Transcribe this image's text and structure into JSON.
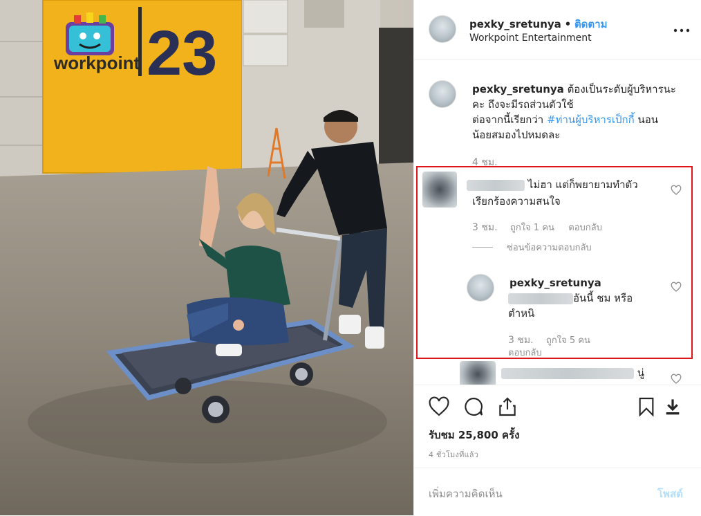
{
  "post": {
    "author": "pexky_sretunya",
    "follow_separator": "•",
    "follow_label": "ติดตาม",
    "location": "Workpoint Entertainment",
    "more_icon": "ellipsis-icon"
  },
  "media": {
    "sign_brand": "workpoint",
    "sign_number": "23"
  },
  "caption": {
    "author": "pexky_sretunya",
    "line1": "ต้องเป็นระดับผู้บริหารนะ",
    "line2": "คะ ถึงจะมีรถส่วนตัวใช้",
    "line3_prefix": "ต่อจากนี้เรียกว่า",
    "hashtag": "#ท่านผู้บริหารเป็กกี้",
    "line3_suffix": "นอน",
    "line4": "น้อยสมองไปหมดละ",
    "time": "4 ชม."
  },
  "comments": [
    {
      "text_line1": "ไม่ฮา แต่ก็พยายามทำตัว",
      "text_line2": "เรียกร้องความสนใจ",
      "time": "3 ชม.",
      "likes": "ถูกใจ 1 คน",
      "reply": "ตอบกลับ",
      "hide_replies": "ซ่อนข้อความตอบกลับ"
    }
  ],
  "reply": {
    "author": "pexky_sretunya",
    "text_line1": "อันนี้ ชม หรือ",
    "text_line2": "ตำหนิ",
    "time": "3 ชม.",
    "likes": "ถูกใจ 5 คน",
    "reply": "ตอบกลับ"
  },
  "partial_comment": {
    "text_tail": "นู่"
  },
  "actions": {
    "icons": [
      "heart-icon",
      "comment-icon",
      "share-icon",
      "bookmark-icon",
      "download-icon"
    ]
  },
  "stats": {
    "views": "รับชม 25,800 ครั้ง",
    "posted": "4 ชั่วโมงที่แล้ว"
  },
  "compose": {
    "placeholder": "เพิ่มความคิดเห็น",
    "post_label": "โพสต์"
  },
  "colors": {
    "link": "#3897f0",
    "highlight_box": "#e0151a",
    "muted": "#8e8e8e"
  }
}
